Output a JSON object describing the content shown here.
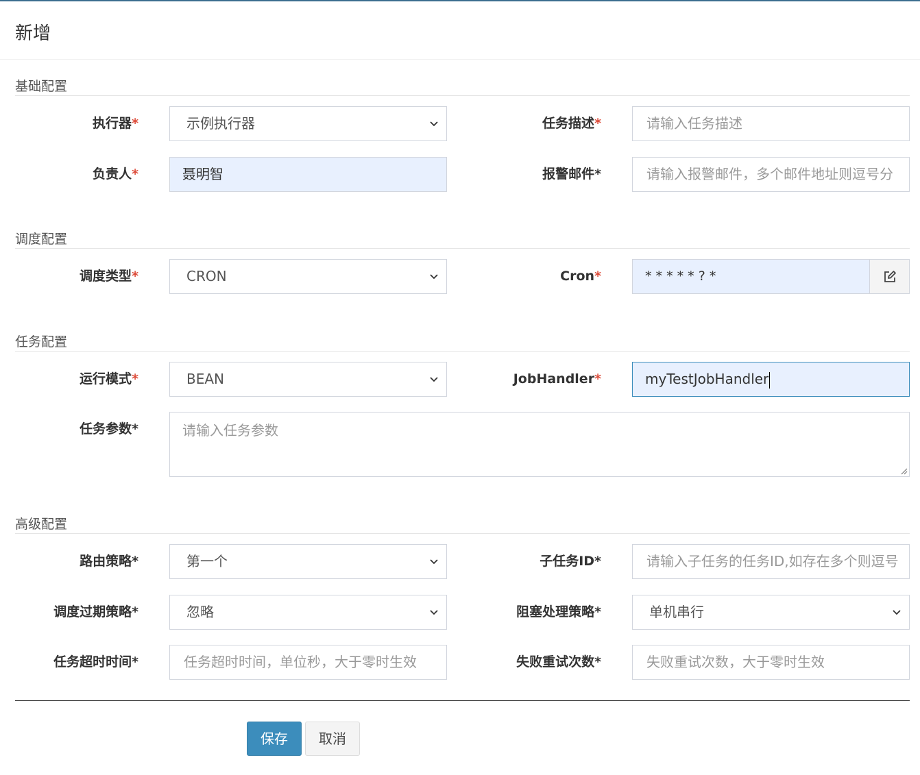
{
  "modal": {
    "title": "新增"
  },
  "sections": {
    "basic": "基础配置",
    "schedule": "调度配置",
    "job": "任务配置",
    "advanced": "高级配置"
  },
  "fields": {
    "executor": {
      "label": "执行器",
      "value": "示例执行器"
    },
    "job_desc": {
      "label": "任务描述",
      "placeholder": "请输入任务描述"
    },
    "author": {
      "label": "负责人",
      "value": "聂明智"
    },
    "alarm_email": {
      "label": "报警邮件*",
      "placeholder": "请输入报警邮件，多个邮件地址则逗号分"
    },
    "schedule_type": {
      "label": "调度类型",
      "value": "CRON"
    },
    "cron": {
      "label": "Cron",
      "value": "* * * * * ? *"
    },
    "glue_type": {
      "label": "运行模式",
      "value": "BEAN"
    },
    "job_handler": {
      "label": "JobHandler",
      "value": "myTestJobHandler"
    },
    "job_param": {
      "label": "任务参数*",
      "placeholder": "请输入任务参数"
    },
    "route_strategy": {
      "label": "路由策略*",
      "value": "第一个"
    },
    "child_job_id": {
      "label": "子任务ID*",
      "placeholder": "请输入子任务的任务ID,如存在多个则逗号"
    },
    "misfire_strategy": {
      "label": "调度过期策略*",
      "value": "忽略"
    },
    "block_strategy": {
      "label": "阻塞处理策略*",
      "value": "单机串行"
    },
    "timeout": {
      "label": "任务超时时间*",
      "placeholder": "任务超时时间，单位秒，大于零时生效"
    },
    "fail_retry": {
      "label": "失败重试次数*",
      "placeholder": "失败重试次数，大于零时生效"
    }
  },
  "required_mark": "*",
  "buttons": {
    "save": "保存",
    "cancel": "取消"
  },
  "colors": {
    "primary": "#3c8dbc",
    "required": "#dd4b39",
    "autofill": "#e8f0fe"
  },
  "icons": {
    "cron_edit": "edit-icon",
    "select": "chevron-down-icon"
  }
}
